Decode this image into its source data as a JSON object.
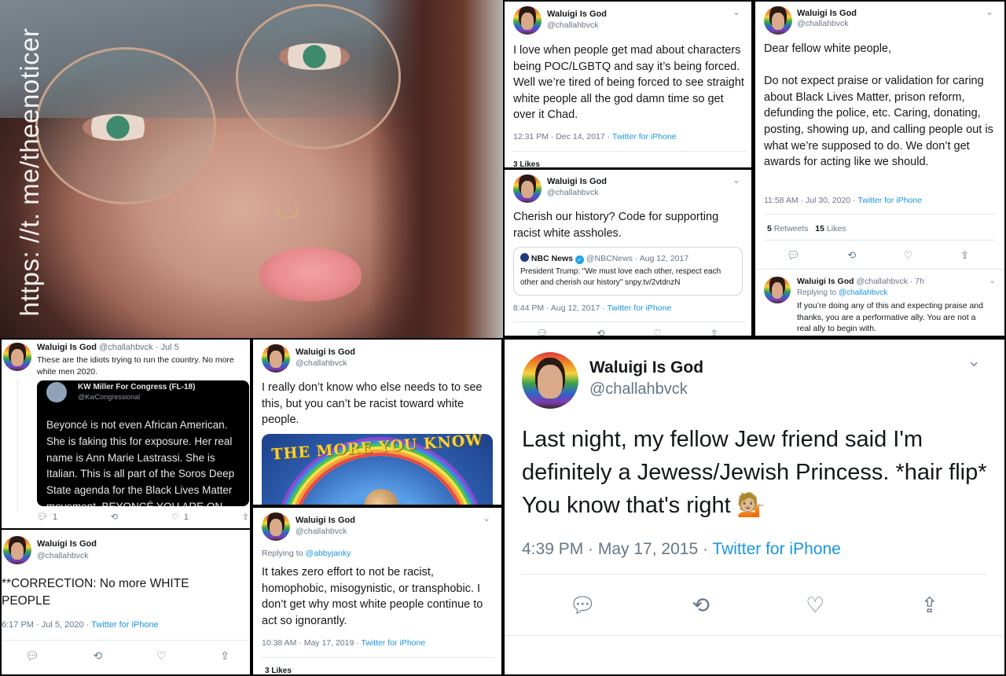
{
  "watermark": "https: //t. me/theenoticer",
  "user": {
    "name": "Waluigi Is God",
    "handle": "@challahbvck"
  },
  "tweets": {
    "t1": {
      "text": "I love when people get mad about characters being POC/LGBTQ and say it’s being forced. Well we’re tired of being forced to see straight white people all the god damn time so get over it Chad.",
      "time": "12:31 PM · Dec 14, 2017 · ",
      "source": "Twitter for iPhone",
      "likes": "3 Likes"
    },
    "t2": {
      "text": "Dear fellow white people,\n\nDo not expect praise or validation for caring about Black Lives Matter, prison reform, defunding the police, etc. Caring, donating, posting, showing up, and calling people out is what we’re supposed to do. We don’t get awards for acting like we should.",
      "time": "11:58 AM · Jul 30, 2020 · ",
      "source": "Twitter for iPhone",
      "retweets_num": "5",
      "retweets_label": " Retweets",
      "likes_num": "15",
      "likes_label": " Likes"
    },
    "t2reply": {
      "handle_time": " @challahbvck · 7h",
      "replying_prefix": "Replying to ",
      "replying_to": "@challahbvck",
      "text": "If you’re doing any of this and expecting praise and thanks, you are a performative ally. You are not a real ally to begin with."
    },
    "t3": {
      "text": "Cherish our history? Code for supporting racist white assholes.",
      "quote_name": "NBC News",
      "quote_handle": " @NBCNews · Aug 12, 2017",
      "quote_text": "President Trump: \"We must love each other, respect each other and cherish our history\" snpy.tv/2vtdnzN",
      "time": "8:44 PM · Aug 12, 2017 · ",
      "source": "Twitter for iPhone"
    },
    "t4": {
      "handle_time": " @challahbvck · Jul 5",
      "text": "These are the idiots trying to run the country. No more white men 2020.",
      "card_name": "KW Miller For Congress (FL-18)",
      "card_handle": "@KwCongressional",
      "card_text": "Beyoncé is not even African American. She is faking this for exposure. Her real name is Ann Marie Lastrassi. She is Italian. This is all part of the Soros Deep State agenda for the Black Lives Matter movement. BEYONCÉ YOU ARE ON",
      "replies": "1",
      "likes": "1"
    },
    "t5": {
      "text": "**CORRECTION: No more WHITE PEOPLE",
      "time": "6:17 PM · Jul 5, 2020 · ",
      "source": "Twitter for iPhone"
    },
    "t6": {
      "text": "I really don’t know who else needs to to see this, but you can’t be racist toward white people.",
      "image_title": "THE MORE YOU KNOW"
    },
    "t7": {
      "replying_prefix": "Replying to ",
      "replying_to": "@abbyjanky",
      "text": "It takes zero effort to not be racist, homophobic, misogynistic, or transphobic. I don’t get why most white people continue to act so ignorantly.",
      "time": "10:38 AM · May 17, 2019 · ",
      "source": "Twitter for iPhone",
      "likes": "3 Likes"
    },
    "t8": {
      "text": "Last night, my fellow Jew friend said I'm definitely a Jewess/Jewish Princess. *hair flip* You know that's right 💁🏼",
      "time": "4:39 PM · May 17, 2015 · ",
      "source": "Twitter for iPhone"
    }
  },
  "icons": [
    "reply-icon",
    "retweet-icon",
    "like-icon",
    "share-icon",
    "chevron-down-icon",
    "verified-icon"
  ]
}
